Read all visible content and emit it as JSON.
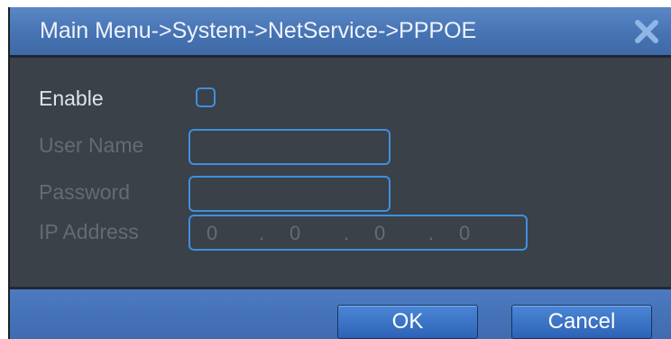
{
  "window": {
    "title": "Main Menu->System->NetService->PPPOE",
    "close_icon": "close-x-icon"
  },
  "form": {
    "enable": {
      "label": "Enable",
      "checked": false
    },
    "username": {
      "label": "User Name",
      "value": ""
    },
    "password": {
      "label": "Password",
      "value": ""
    },
    "ip_address": {
      "label": "IP Address",
      "octets": [
        "0",
        "0",
        "0",
        "0"
      ],
      "separator": "."
    }
  },
  "buttons": {
    "ok_label": "OK",
    "cancel_label": "Cancel"
  },
  "colors": {
    "titlebar": "#4673b3",
    "panel": "#3a4148",
    "field_border": "#3f8fe0",
    "label_active": "#dde3ef",
    "label_disabled": "#646b73",
    "button": "#3a74c6"
  }
}
